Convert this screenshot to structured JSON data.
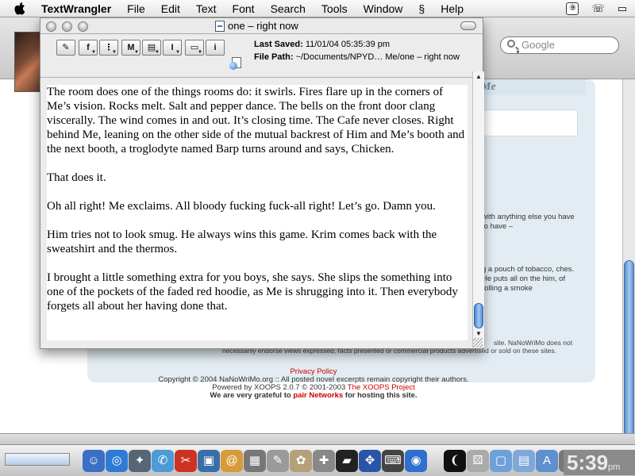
{
  "menubar": {
    "app_name": "TextWrangler",
    "items": [
      "File",
      "Edit",
      "Text",
      "Font",
      "Search",
      "Tools",
      "Window",
      "Help"
    ]
  },
  "browser": {
    "search_placeholder": "Google",
    "header_title": "Me",
    "side_text_1": "with anything else you have to have –",
    "side_text_2": "g a pouch of tobacco, ches. He puts all on the him, of rolling a smoke",
    "disclaimer_lead": "site. NaNoWriMo does not",
    "disclaimer_tail": "necessarily endorse views expressed, facts presented or commercial products advertised or sold on these sites.",
    "footer": {
      "privacy": "Privacy Policy",
      "copyright": "Copyright © 2004 NaNoWriMo.org :: All posted novel excerpts remain copyright their authors.",
      "powered_prefix": "Powered by XOOPS 2.0.7 © 2001-2003 ",
      "xoops_link": "The XOOPS Project",
      "grateful_prefix": "We are very grateful to ",
      "pair_link": "pair Networks",
      "grateful_suffix": " for hosting this site."
    }
  },
  "textwrangler": {
    "title": "one – right now",
    "last_saved_label": "Last Saved:",
    "last_saved_value": "11/01/04 05:35:39 pm",
    "file_path_label": "File Path:",
    "file_path_value": "~/Documents/NPYD… Me/one – right now",
    "toolbar_glyphs": [
      "✎",
      "f",
      "⋮",
      "M",
      "▤",
      "I",
      "▭",
      "i"
    ],
    "paragraphs": [
      "The room does one of the things rooms do: it swirls. Fires flare up in the corners of Me’s vision. Rocks melt. Salt and pepper dance. The bells on the front door clang viscerally. The wind comes in and out. It’s closing time. The Cafe never closes. Right behind Me, leaning on the other side of the mutual backrest of Him and Me’s booth and the next booth, a troglodyte named Barp turns around and says, Chicken.",
      "That does it.",
      "Oh all right! Me exclaims. All bloody fucking fuck-all right! Let’s go. Damn you.",
      "Him tries not to look smug. He always wins this game. Krim comes back with the sweatshirt and the thermos.",
      "I brought a little something extra for you boys, she says. She slips the something into one of the pockets of the faded red hoodie, as Me is shrugging into it. Then everybody forgets all about her having done that."
    ]
  },
  "dock": {
    "clock_time": "5:39",
    "clock_period": "pm",
    "icons": [
      {
        "name": "finder-icon",
        "glyph": "☺",
        "color": "#3b6fc4"
      },
      {
        "name": "safari-icon",
        "glyph": "◎",
        "color": "#2d7bd6"
      },
      {
        "name": "app-icon",
        "glyph": "✦",
        "color": "#556677"
      },
      {
        "name": "ichat-icon",
        "glyph": "✆",
        "color": "#4d9ad8"
      },
      {
        "name": "tool-icon",
        "glyph": "✂",
        "color": "#cc3322"
      },
      {
        "name": "photo-icon",
        "glyph": "▣",
        "color": "#3a6ea8"
      },
      {
        "name": "address-icon",
        "glyph": "@",
        "color": "#d89b3a"
      },
      {
        "name": "calculator-icon",
        "glyph": "▦",
        "color": "#777777"
      },
      {
        "name": "textedit-icon",
        "glyph": "✎",
        "color": "#9a9a9a"
      },
      {
        "name": "image-icon",
        "glyph": "✿",
        "color": "#b4a07a"
      },
      {
        "name": "utility-icon",
        "glyph": "✚",
        "color": "#888888"
      },
      {
        "name": "terminal-icon",
        "glyph": "▰",
        "color": "#222222"
      },
      {
        "name": "textwrangler-icon",
        "glyph": "✥",
        "color": "#2855a8"
      },
      {
        "name": "keyboard-icon",
        "glyph": "⌨",
        "color": "#444444"
      },
      {
        "name": "network-icon",
        "glyph": "◉",
        "color": "#2f6fcf"
      },
      {
        "name": "document-icon",
        "glyph": "❨",
        "color": "#111111"
      },
      {
        "name": "dice-icon",
        "glyph": "⚄",
        "color": "#aaaaaa"
      },
      {
        "name": "folder-icon",
        "glyph": "▢",
        "color": "#6fa0d8"
      },
      {
        "name": "folder2-icon",
        "glyph": "▤",
        "color": "#7fa8d8"
      },
      {
        "name": "applications-icon",
        "glyph": "A",
        "color": "#5f8fcf"
      },
      {
        "name": "trash-icon",
        "glyph": "🗑",
        "color": "#777777"
      }
    ]
  }
}
